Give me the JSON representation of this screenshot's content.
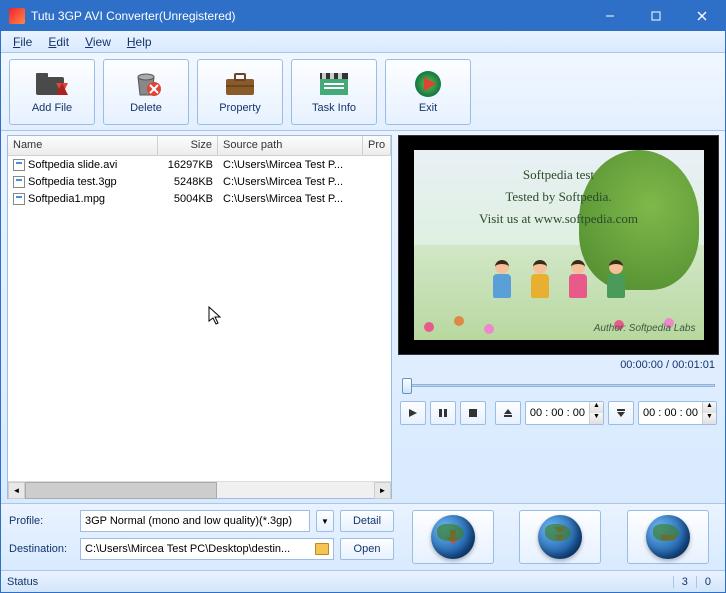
{
  "window": {
    "title": "Tutu 3GP AVI Converter(Unregistered)"
  },
  "menu": {
    "file": "File",
    "edit": "Edit",
    "view": "View",
    "help": "Help"
  },
  "toolbar": {
    "addfile": "Add File",
    "delete": "Delete",
    "property": "Property",
    "taskinfo": "Task Info",
    "exit": "Exit"
  },
  "columns": {
    "name": "Name",
    "size": "Size",
    "source": "Source path",
    "pro": "Pro"
  },
  "colwidths": {
    "name": 150,
    "size": 60,
    "source": 145,
    "pro": 28
  },
  "files": [
    {
      "name": "Softpedia slide.avi",
      "size": "16297KB",
      "source": "C:\\Users\\Mircea Test P..."
    },
    {
      "name": "Softpedia test.3gp",
      "size": "5248KB",
      "source": "C:\\Users\\Mircea Test P..."
    },
    {
      "name": "Softpedia1.mpg",
      "size": "5004KB",
      "source": "C:\\Users\\Mircea Test P..."
    }
  ],
  "preview": {
    "line1": "Softpedia test",
    "line2": "Tested by Softpedia.",
    "line3": "Visit us at www.softpedia.com",
    "author": "Author: Softpedia Labs"
  },
  "time": {
    "display": "00:00:00 / 00:01:01",
    "start": "00 : 00 : 00",
    "end": "00 : 00 : 00"
  },
  "profile": {
    "label": "Profile:",
    "value": "3GP Normal (mono and low quality)(*.3gp)",
    "detail": "Detail"
  },
  "destination": {
    "label": "Destination:",
    "value": "C:\\Users\\Mircea Test PC\\Desktop\\destin...",
    "open": "Open"
  },
  "status": {
    "label": "Status",
    "count1": "3",
    "count2": "0"
  }
}
